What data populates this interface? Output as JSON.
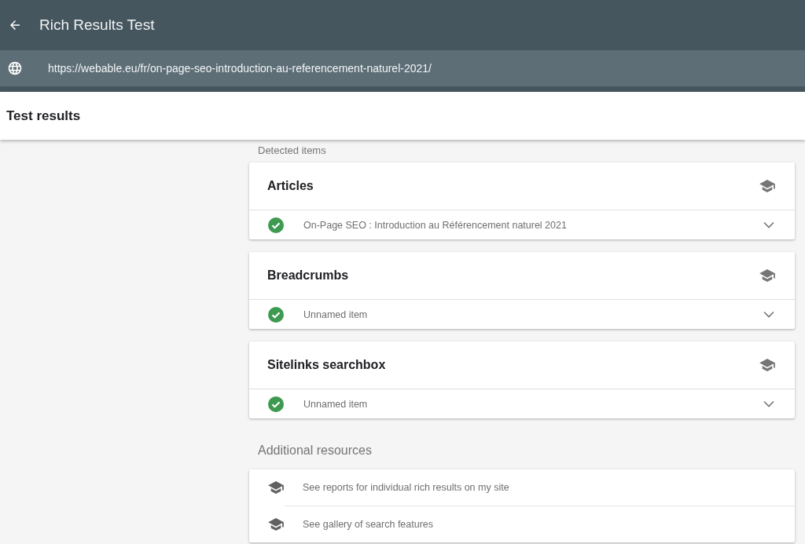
{
  "app_bar": {
    "title": "Rich Results Test"
  },
  "url_bar": {
    "url": "https://webable.eu/fr/on-page-seo-introduction-au-referencement-naturel-2021/"
  },
  "results_header": {
    "title": "Test results"
  },
  "detected": {
    "heading": "Detected items",
    "groups": [
      {
        "title": "Articles",
        "items": [
          {
            "name": "On-Page SEO : Introduction au Référencement naturel 2021",
            "valid": true,
            "expanded": false
          }
        ]
      },
      {
        "title": "Breadcrumbs",
        "items": [
          {
            "name": "Unnamed item",
            "valid": true,
            "expanded": false
          }
        ]
      },
      {
        "title": "Sitelinks searchbox",
        "items": [
          {
            "name": "Unnamed item",
            "valid": true,
            "expanded": false
          }
        ]
      }
    ]
  },
  "resources": {
    "heading": "Additional resources",
    "links": [
      {
        "label": "See reports for individual rich results on my site"
      },
      {
        "label": "See gallery of search features"
      }
    ]
  }
}
